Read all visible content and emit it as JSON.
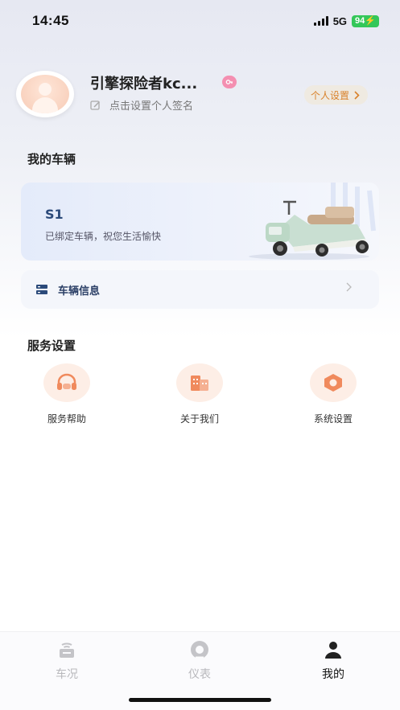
{
  "status_bar": {
    "time": "14:45",
    "network": "5G",
    "battery": "94"
  },
  "profile": {
    "username": "引擎探险者kc...",
    "signature_hint": "点击设置个人签名",
    "settings_button": "个人设置"
  },
  "vehicles": {
    "section_title": "我的车辆",
    "card": {
      "model": "S1",
      "description": "已绑定车辆，祝您生活愉快"
    },
    "info_row_label": "车辆信息"
  },
  "services": {
    "section_title": "服务设置",
    "items": [
      {
        "label": "服务帮助",
        "icon": "headset-icon"
      },
      {
        "label": "关于我们",
        "icon": "building-icon"
      },
      {
        "label": "系统设置",
        "icon": "hex-nut-icon"
      }
    ]
  },
  "tabbar": {
    "tabs": [
      {
        "label": "车况",
        "icon": "vehicle-status-icon",
        "active": false
      },
      {
        "label": "仪表",
        "icon": "gauge-icon",
        "active": false
      },
      {
        "label": "我的",
        "icon": "person-icon",
        "active": true
      }
    ]
  },
  "colors": {
    "accent_orange": "#d9822b",
    "title_blue": "#2b4a7a",
    "battery_green": "#34c759"
  }
}
